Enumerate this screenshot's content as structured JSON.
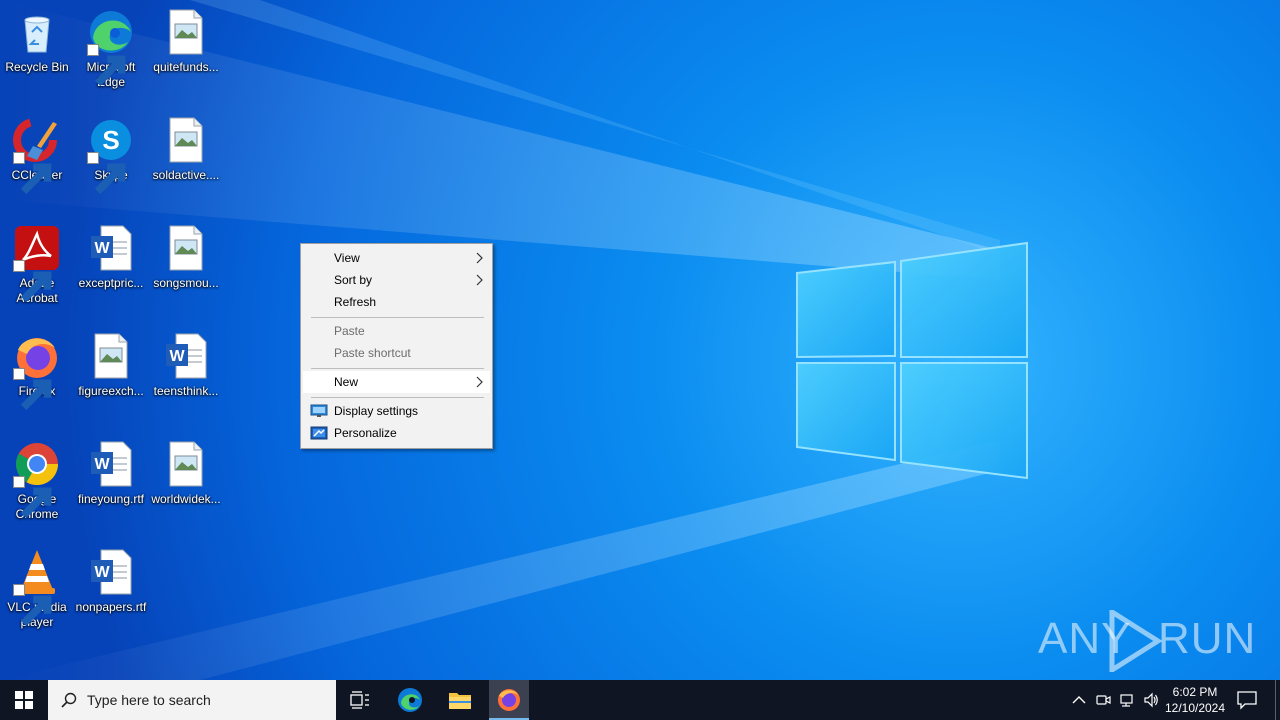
{
  "desktop": {
    "icons": [
      {
        "label": "Recycle Bin",
        "icon": "recycle-bin-icon"
      },
      {
        "label": "Microsoft Edge",
        "icon": "edge-icon"
      },
      {
        "label": "quitefunds...",
        "icon": "image-file-icon"
      },
      {
        "label": "CCleaner",
        "icon": "ccleaner-icon"
      },
      {
        "label": "Skype",
        "icon": "skype-icon"
      },
      {
        "label": "soldactive....",
        "icon": "image-file-icon"
      },
      {
        "label": "Adobe Acrobat",
        "icon": "acrobat-icon"
      },
      {
        "label": "exceptpric...",
        "icon": "word-file-icon"
      },
      {
        "label": "songsmou...",
        "icon": "image-file-icon"
      },
      {
        "label": "Firefox",
        "icon": "firefox-icon"
      },
      {
        "label": "figureexch...",
        "icon": "image-file-icon"
      },
      {
        "label": "teensthink...",
        "icon": "word-file-icon"
      },
      {
        "label": "Google Chrome",
        "icon": "chrome-icon"
      },
      {
        "label": "fineyoung.rtf",
        "icon": "word-file-icon"
      },
      {
        "label": "worldwidek...",
        "icon": "image-file-icon"
      },
      {
        "label": "VLC media player",
        "icon": "vlc-icon"
      },
      {
        "label": "nonpapers.rtf",
        "icon": "word-file-icon"
      }
    ]
  },
  "context_menu": {
    "view": "View",
    "sort_by": "Sort by",
    "refresh": "Refresh",
    "paste": "Paste",
    "paste_shortcut": "Paste shortcut",
    "new": "New",
    "display_settings": "Display settings",
    "personalize": "Personalize"
  },
  "watermark": {
    "left": "ANY",
    "right": "RUN"
  },
  "taskbar": {
    "search_placeholder": "Type here to search",
    "time": "6:02 PM",
    "date": "12/10/2024"
  },
  "colors": {
    "taskbar_bg": "#0f1522",
    "menu_bg": "#f2f2f2",
    "accent": "#76b9ed",
    "wallpaper_blue": "#0a5fd8"
  }
}
